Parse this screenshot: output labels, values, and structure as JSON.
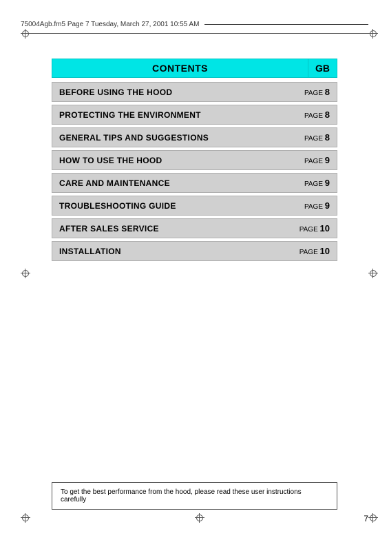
{
  "header": {
    "filename": "75004Agb.fm5  Page 7  Tuesday, March 27, 2001  10:55 AM"
  },
  "contents": {
    "title": "CONTENTS",
    "gb_label": "GB"
  },
  "toc_rows": [
    {
      "label": "BEFORE USING THE HOOD",
      "page_word": "PAGE",
      "page_num": "8"
    },
    {
      "label": "PROTECTING THE ENVIRONMENT",
      "page_word": "PAGE",
      "page_num": "8"
    },
    {
      "label": "GENERAL TIPS AND SUGGESTIONS",
      "page_word": "PAGE",
      "page_num": "8"
    },
    {
      "label": "HOW TO USE THE HOOD",
      "page_word": "PAGE",
      "page_num": "9"
    },
    {
      "label": "CARE AND MAINTENANCE",
      "page_word": "PAGE",
      "page_num": "9"
    },
    {
      "label": "TROUBLESHOOTING GUIDE",
      "page_word": "PAGE",
      "page_num": "9"
    },
    {
      "label": "AFTER SALES SERVICE",
      "page_word": "PAGE",
      "page_num": "10"
    },
    {
      "label": "INSTALLATION",
      "page_word": "PAGE",
      "page_num": "10"
    }
  ],
  "footer": {
    "text": "To get the best performance from the hood, please read these user instructions carefully"
  },
  "page_number": "7"
}
